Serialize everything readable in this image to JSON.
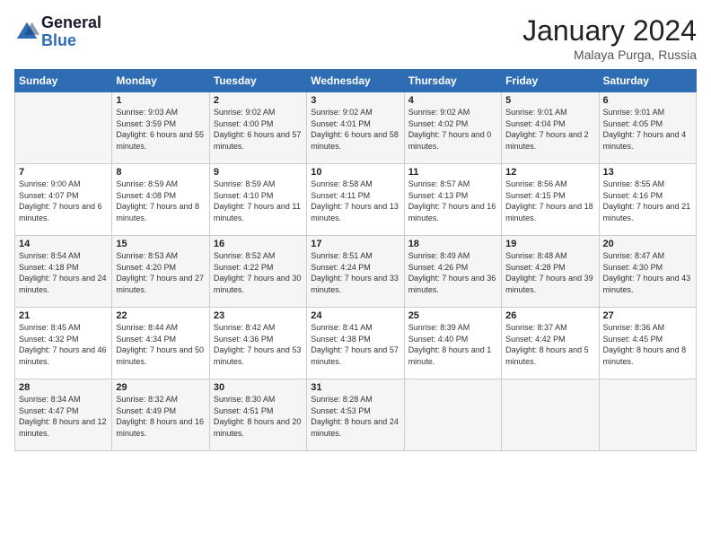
{
  "logo": {
    "line1": "General",
    "line2": "Blue"
  },
  "title": "January 2024",
  "location": "Malaya Purga, Russia",
  "days_header": [
    "Sunday",
    "Monday",
    "Tuesday",
    "Wednesday",
    "Thursday",
    "Friday",
    "Saturday"
  ],
  "weeks": [
    [
      {
        "day": "",
        "info": ""
      },
      {
        "day": "1",
        "sunrise": "9:03 AM",
        "sunset": "3:59 PM",
        "daylight": "6 hours and 55 minutes."
      },
      {
        "day": "2",
        "sunrise": "9:02 AM",
        "sunset": "4:00 PM",
        "daylight": "6 hours and 57 minutes."
      },
      {
        "day": "3",
        "sunrise": "9:02 AM",
        "sunset": "4:01 PM",
        "daylight": "6 hours and 58 minutes."
      },
      {
        "day": "4",
        "sunrise": "9:02 AM",
        "sunset": "4:02 PM",
        "daylight": "7 hours and 0 minutes."
      },
      {
        "day": "5",
        "sunrise": "9:01 AM",
        "sunset": "4:04 PM",
        "daylight": "7 hours and 2 minutes."
      },
      {
        "day": "6",
        "sunrise": "9:01 AM",
        "sunset": "4:05 PM",
        "daylight": "7 hours and 4 minutes."
      }
    ],
    [
      {
        "day": "7",
        "sunrise": "9:00 AM",
        "sunset": "4:07 PM",
        "daylight": "7 hours and 6 minutes."
      },
      {
        "day": "8",
        "sunrise": "8:59 AM",
        "sunset": "4:08 PM",
        "daylight": "7 hours and 8 minutes."
      },
      {
        "day": "9",
        "sunrise": "8:59 AM",
        "sunset": "4:10 PM",
        "daylight": "7 hours and 11 minutes."
      },
      {
        "day": "10",
        "sunrise": "8:58 AM",
        "sunset": "4:11 PM",
        "daylight": "7 hours and 13 minutes."
      },
      {
        "day": "11",
        "sunrise": "8:57 AM",
        "sunset": "4:13 PM",
        "daylight": "7 hours and 16 minutes."
      },
      {
        "day": "12",
        "sunrise": "8:56 AM",
        "sunset": "4:15 PM",
        "daylight": "7 hours and 18 minutes."
      },
      {
        "day": "13",
        "sunrise": "8:55 AM",
        "sunset": "4:16 PM",
        "daylight": "7 hours and 21 minutes."
      }
    ],
    [
      {
        "day": "14",
        "sunrise": "8:54 AM",
        "sunset": "4:18 PM",
        "daylight": "7 hours and 24 minutes."
      },
      {
        "day": "15",
        "sunrise": "8:53 AM",
        "sunset": "4:20 PM",
        "daylight": "7 hours and 27 minutes."
      },
      {
        "day": "16",
        "sunrise": "8:52 AM",
        "sunset": "4:22 PM",
        "daylight": "7 hours and 30 minutes."
      },
      {
        "day": "17",
        "sunrise": "8:51 AM",
        "sunset": "4:24 PM",
        "daylight": "7 hours and 33 minutes."
      },
      {
        "day": "18",
        "sunrise": "8:49 AM",
        "sunset": "4:26 PM",
        "daylight": "7 hours and 36 minutes."
      },
      {
        "day": "19",
        "sunrise": "8:48 AM",
        "sunset": "4:28 PM",
        "daylight": "7 hours and 39 minutes."
      },
      {
        "day": "20",
        "sunrise": "8:47 AM",
        "sunset": "4:30 PM",
        "daylight": "7 hours and 43 minutes."
      }
    ],
    [
      {
        "day": "21",
        "sunrise": "8:45 AM",
        "sunset": "4:32 PM",
        "daylight": "7 hours and 46 minutes."
      },
      {
        "day": "22",
        "sunrise": "8:44 AM",
        "sunset": "4:34 PM",
        "daylight": "7 hours and 50 minutes."
      },
      {
        "day": "23",
        "sunrise": "8:42 AM",
        "sunset": "4:36 PM",
        "daylight": "7 hours and 53 minutes."
      },
      {
        "day": "24",
        "sunrise": "8:41 AM",
        "sunset": "4:38 PM",
        "daylight": "7 hours and 57 minutes."
      },
      {
        "day": "25",
        "sunrise": "8:39 AM",
        "sunset": "4:40 PM",
        "daylight": "8 hours and 1 minute."
      },
      {
        "day": "26",
        "sunrise": "8:37 AM",
        "sunset": "4:42 PM",
        "daylight": "8 hours and 5 minutes."
      },
      {
        "day": "27",
        "sunrise": "8:36 AM",
        "sunset": "4:45 PM",
        "daylight": "8 hours and 8 minutes."
      }
    ],
    [
      {
        "day": "28",
        "sunrise": "8:34 AM",
        "sunset": "4:47 PM",
        "daylight": "8 hours and 12 minutes."
      },
      {
        "day": "29",
        "sunrise": "8:32 AM",
        "sunset": "4:49 PM",
        "daylight": "8 hours and 16 minutes."
      },
      {
        "day": "30",
        "sunrise": "8:30 AM",
        "sunset": "4:51 PM",
        "daylight": "8 hours and 20 minutes."
      },
      {
        "day": "31",
        "sunrise": "8:28 AM",
        "sunset": "4:53 PM",
        "daylight": "8 hours and 24 minutes."
      },
      {
        "day": "",
        "info": ""
      },
      {
        "day": "",
        "info": ""
      },
      {
        "day": "",
        "info": ""
      }
    ]
  ]
}
